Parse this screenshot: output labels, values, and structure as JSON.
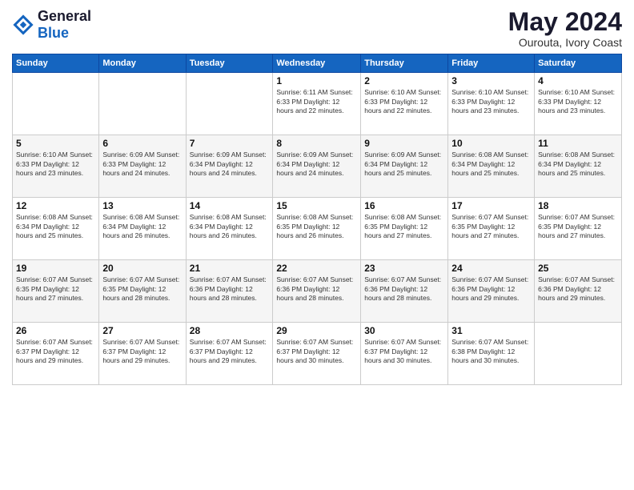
{
  "header": {
    "logo_line1": "General",
    "logo_line2": "Blue",
    "month": "May 2024",
    "location": "Ourouta, Ivory Coast"
  },
  "days_of_week": [
    "Sunday",
    "Monday",
    "Tuesday",
    "Wednesday",
    "Thursday",
    "Friday",
    "Saturday"
  ],
  "weeks": [
    [
      {
        "day": "",
        "info": ""
      },
      {
        "day": "",
        "info": ""
      },
      {
        "day": "",
        "info": ""
      },
      {
        "day": "1",
        "info": "Sunrise: 6:11 AM\nSunset: 6:33 PM\nDaylight: 12 hours\nand 22 minutes."
      },
      {
        "day": "2",
        "info": "Sunrise: 6:10 AM\nSunset: 6:33 PM\nDaylight: 12 hours\nand 22 minutes."
      },
      {
        "day": "3",
        "info": "Sunrise: 6:10 AM\nSunset: 6:33 PM\nDaylight: 12 hours\nand 23 minutes."
      },
      {
        "day": "4",
        "info": "Sunrise: 6:10 AM\nSunset: 6:33 PM\nDaylight: 12 hours\nand 23 minutes."
      }
    ],
    [
      {
        "day": "5",
        "info": "Sunrise: 6:10 AM\nSunset: 6:33 PM\nDaylight: 12 hours\nand 23 minutes."
      },
      {
        "day": "6",
        "info": "Sunrise: 6:09 AM\nSunset: 6:33 PM\nDaylight: 12 hours\nand 24 minutes."
      },
      {
        "day": "7",
        "info": "Sunrise: 6:09 AM\nSunset: 6:34 PM\nDaylight: 12 hours\nand 24 minutes."
      },
      {
        "day": "8",
        "info": "Sunrise: 6:09 AM\nSunset: 6:34 PM\nDaylight: 12 hours\nand 24 minutes."
      },
      {
        "day": "9",
        "info": "Sunrise: 6:09 AM\nSunset: 6:34 PM\nDaylight: 12 hours\nand 25 minutes."
      },
      {
        "day": "10",
        "info": "Sunrise: 6:08 AM\nSunset: 6:34 PM\nDaylight: 12 hours\nand 25 minutes."
      },
      {
        "day": "11",
        "info": "Sunrise: 6:08 AM\nSunset: 6:34 PM\nDaylight: 12 hours\nand 25 minutes."
      }
    ],
    [
      {
        "day": "12",
        "info": "Sunrise: 6:08 AM\nSunset: 6:34 PM\nDaylight: 12 hours\nand 25 minutes."
      },
      {
        "day": "13",
        "info": "Sunrise: 6:08 AM\nSunset: 6:34 PM\nDaylight: 12 hours\nand 26 minutes."
      },
      {
        "day": "14",
        "info": "Sunrise: 6:08 AM\nSunset: 6:34 PM\nDaylight: 12 hours\nand 26 minutes."
      },
      {
        "day": "15",
        "info": "Sunrise: 6:08 AM\nSunset: 6:35 PM\nDaylight: 12 hours\nand 26 minutes."
      },
      {
        "day": "16",
        "info": "Sunrise: 6:08 AM\nSunset: 6:35 PM\nDaylight: 12 hours\nand 27 minutes."
      },
      {
        "day": "17",
        "info": "Sunrise: 6:07 AM\nSunset: 6:35 PM\nDaylight: 12 hours\nand 27 minutes."
      },
      {
        "day": "18",
        "info": "Sunrise: 6:07 AM\nSunset: 6:35 PM\nDaylight: 12 hours\nand 27 minutes."
      }
    ],
    [
      {
        "day": "19",
        "info": "Sunrise: 6:07 AM\nSunset: 6:35 PM\nDaylight: 12 hours\nand 27 minutes."
      },
      {
        "day": "20",
        "info": "Sunrise: 6:07 AM\nSunset: 6:35 PM\nDaylight: 12 hours\nand 28 minutes."
      },
      {
        "day": "21",
        "info": "Sunrise: 6:07 AM\nSunset: 6:36 PM\nDaylight: 12 hours\nand 28 minutes."
      },
      {
        "day": "22",
        "info": "Sunrise: 6:07 AM\nSunset: 6:36 PM\nDaylight: 12 hours\nand 28 minutes."
      },
      {
        "day": "23",
        "info": "Sunrise: 6:07 AM\nSunset: 6:36 PM\nDaylight: 12 hours\nand 28 minutes."
      },
      {
        "day": "24",
        "info": "Sunrise: 6:07 AM\nSunset: 6:36 PM\nDaylight: 12 hours\nand 29 minutes."
      },
      {
        "day": "25",
        "info": "Sunrise: 6:07 AM\nSunset: 6:36 PM\nDaylight: 12 hours\nand 29 minutes."
      }
    ],
    [
      {
        "day": "26",
        "info": "Sunrise: 6:07 AM\nSunset: 6:37 PM\nDaylight: 12 hours\nand 29 minutes."
      },
      {
        "day": "27",
        "info": "Sunrise: 6:07 AM\nSunset: 6:37 PM\nDaylight: 12 hours\nand 29 minutes."
      },
      {
        "day": "28",
        "info": "Sunrise: 6:07 AM\nSunset: 6:37 PM\nDaylight: 12 hours\nand 29 minutes."
      },
      {
        "day": "29",
        "info": "Sunrise: 6:07 AM\nSunset: 6:37 PM\nDaylight: 12 hours\nand 30 minutes."
      },
      {
        "day": "30",
        "info": "Sunrise: 6:07 AM\nSunset: 6:37 PM\nDaylight: 12 hours\nand 30 minutes."
      },
      {
        "day": "31",
        "info": "Sunrise: 6:07 AM\nSunset: 6:38 PM\nDaylight: 12 hours\nand 30 minutes."
      },
      {
        "day": "",
        "info": ""
      }
    ]
  ]
}
